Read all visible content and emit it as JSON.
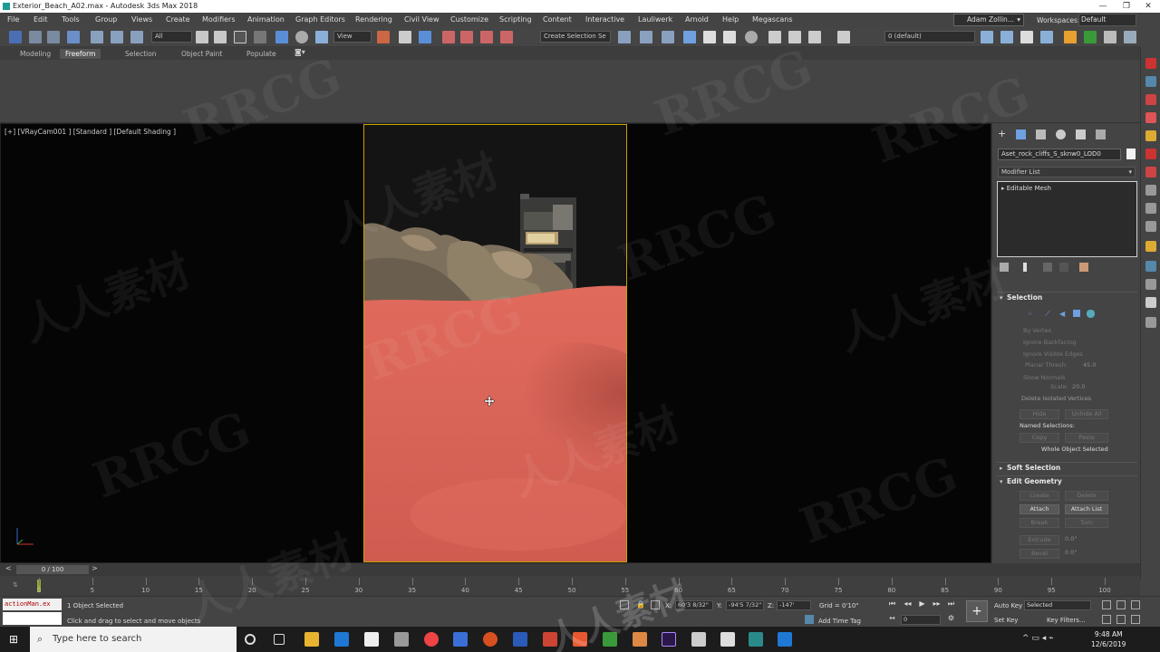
{
  "window": {
    "title": "Exterior_Beach_A02.max - Autodesk 3ds Max 2018",
    "minimize": "—",
    "maximize": "❐",
    "close": "✕"
  },
  "menu": [
    "File",
    "Edit",
    "Tools",
    "Group",
    "Views",
    "Create",
    "Modifiers",
    "Animation",
    "Graph Editors",
    "Rendering",
    "Civil View",
    "Customize",
    "Scripting",
    "Content",
    "Interactive",
    "Lauliwerk",
    "Arnold",
    "Help",
    "Megascans"
  ],
  "user": "Adam Zollin...",
  "workspace": {
    "label": "Workspaces:",
    "value": "Default"
  },
  "toolbar": {
    "filter": "All",
    "ref_coord": "View",
    "selection_set": "Create Selection Se",
    "layer": "0 (default)"
  },
  "ribbon_tabs": [
    {
      "label": "Modeling",
      "active": false
    },
    {
      "label": "Freeform",
      "active": true
    },
    {
      "label": "Selection",
      "active": false
    },
    {
      "label": "Object Paint",
      "active": false
    },
    {
      "label": "Populate",
      "active": false
    }
  ],
  "viewport": {
    "label": "[+] [VRayCam001 ] [Standard ] [Default Shading ]"
  },
  "command_panel": {
    "object_name": "Aset_rock_cliffs_S_sknw0_LOD0",
    "modifier_list": "Modifier List",
    "stack_item": "Editable Mesh",
    "selection": {
      "title": "Selection",
      "by_vertex": "By Vertex",
      "ignore_backfacing": "Ignore Backfacing",
      "ignore_visible_edges": "Ignore Visible Edges",
      "planar_thresh": "Planar Thresh:",
      "planar_value": "45.0",
      "show_normals": "Show Normals",
      "scale": "Scale:",
      "scale_value": "20.0",
      "delete_isolated": "Delete Isolated Vertices",
      "hide": "Hide",
      "unhide_all": "Unhide All",
      "named_selections": "Named Selections:",
      "copy": "Copy",
      "paste": "Paste",
      "status": "Whole Object Selected"
    },
    "soft_selection": "Soft Selection",
    "edit_geometry": {
      "title": "Edit Geometry",
      "create": "Create",
      "delete": "Delete",
      "attach": "Attach",
      "attach_list": "Attach List",
      "break": "Break",
      "turn": "Turn",
      "extrude": "Extrude",
      "extrude_value": "0.0\"",
      "bevel": "Bevel",
      "bevel_value": "0.0\""
    }
  },
  "timeline": {
    "frame": "0 / 100",
    "ticks": [
      "0",
      "5",
      "10",
      "15",
      "20",
      "25",
      "30",
      "35",
      "40",
      "45",
      "50",
      "55",
      "60",
      "65",
      "70",
      "75",
      "80",
      "85",
      "90",
      "95",
      "100"
    ]
  },
  "status": {
    "maxscript": "actionMan.ex",
    "objects_selected": "1 Object Selected",
    "prompt": "Click and drag to select and move objects",
    "x_label": "X:",
    "x_value": "60'3 8/32\"",
    "y_label": "Y:",
    "y_value": "-94'5 7/32\"",
    "z_label": "Z:",
    "z_value": "-147'",
    "grid": "Grid = 0'10\"",
    "add_time_tag": "Add Time Tag",
    "auto_key": "Auto Key",
    "set_key": "Set Key",
    "selected": "Selected",
    "key_filters": "Key Filters...",
    "frame_field": "0"
  },
  "taskbar": {
    "search_placeholder": "Type here to search",
    "time": "9:48 AM",
    "date": "12/6/2019"
  },
  "watermarks": [
    "RRCG",
    "人人素材"
  ]
}
